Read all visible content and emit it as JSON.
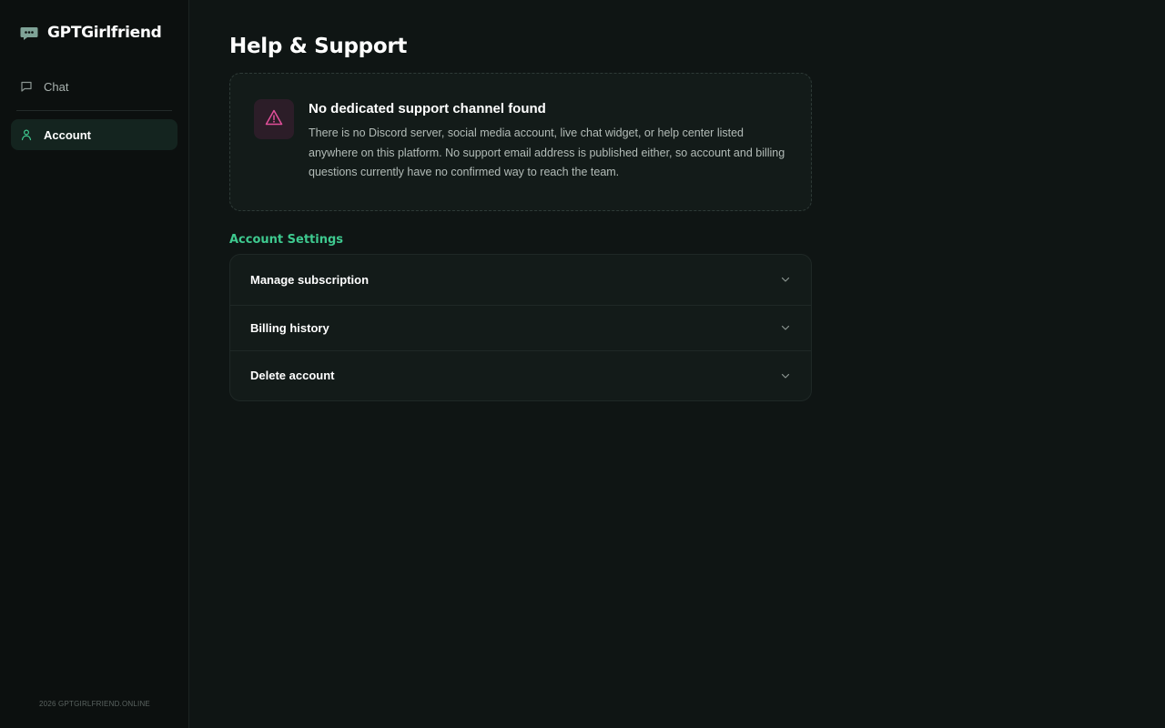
{
  "brand": {
    "name": "GPTGirlfriend"
  },
  "sidebar": {
    "items": [
      {
        "label": "Chat",
        "icon": "chat-bubble-icon",
        "active": false
      },
      {
        "label": "Account",
        "icon": "user-icon",
        "active": true
      }
    ],
    "footer": "2026 GPTGIRLFRIEND.ONLINE"
  },
  "main": {
    "title": "Help & Support",
    "alert": {
      "icon": "warning-triangle-icon",
      "title": "No dedicated support channel found",
      "text": "There is no Discord server, social media account, live chat widget, or help center listed anywhere on this platform. No support email address is published either, so account and billing questions currently have no confirmed way to reach the team."
    },
    "account_settings": {
      "label": "Account Settings",
      "items": [
        {
          "label": "Manage subscription"
        },
        {
          "label": "Billing history"
        },
        {
          "label": "Delete account"
        }
      ]
    }
  },
  "colors": {
    "accent": "#3ec98f",
    "background": "#0f1514",
    "sidebar": "#0c100f",
    "card": "#131b19",
    "warning": "#e24f9a"
  }
}
